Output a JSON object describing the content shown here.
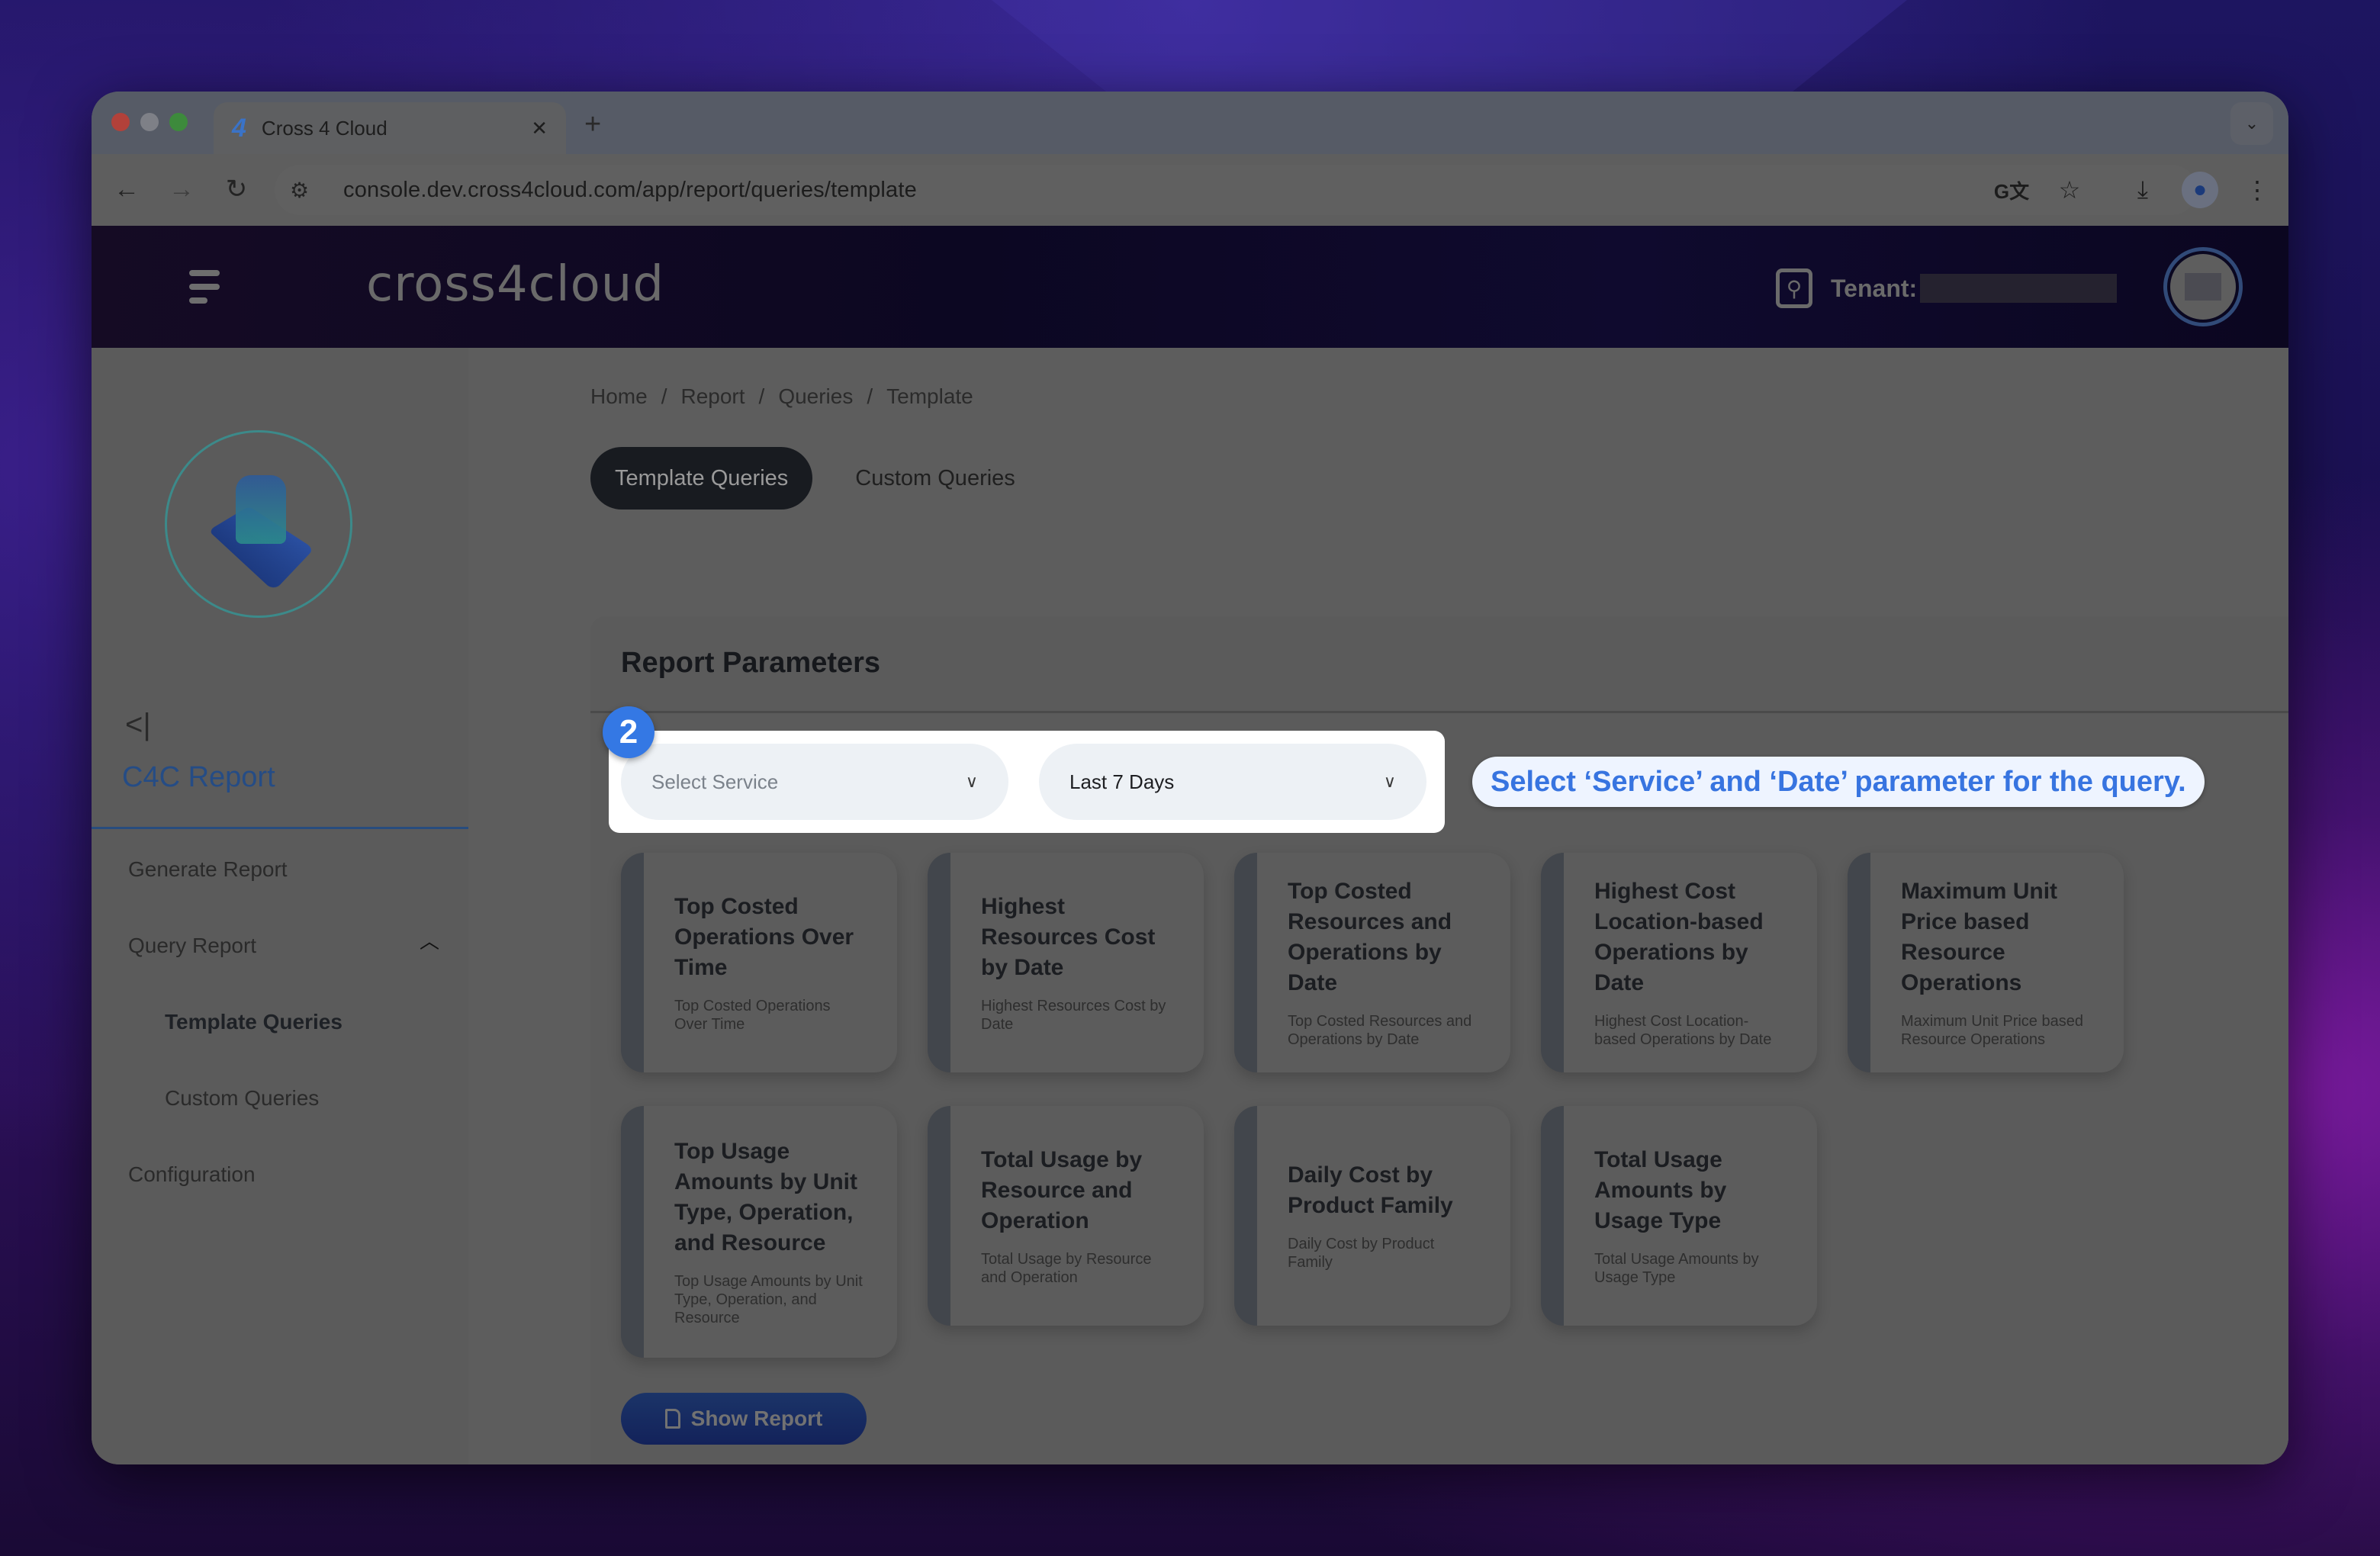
{
  "browser": {
    "tab_title": "Cross 4 Cloud",
    "tab_favicon": "4",
    "new_tab_label": "+",
    "url": "console.dev.cross4cloud.com/app/report/queries/template"
  },
  "header": {
    "logo_text": "cross4cloud",
    "tenant_label": "Tenant:",
    "tenant_value": ""
  },
  "sidebar": {
    "section_title": "C4C Report",
    "collapse_glyph": "<|",
    "items": [
      {
        "label": "Generate Report"
      },
      {
        "label": "Query Report",
        "expanded": true
      },
      {
        "label": "Template Queries",
        "active": true,
        "sub": true
      },
      {
        "label": "Custom Queries",
        "sub": true
      },
      {
        "label": "Configuration"
      }
    ]
  },
  "breadcrumb": [
    "Home",
    "Report",
    "Queries",
    "Template"
  ],
  "tabs": [
    {
      "label": "Template Queries",
      "active": true
    },
    {
      "label": "Custom Queries",
      "active": false
    }
  ],
  "panel": {
    "title": "Report Parameters",
    "service_select": {
      "placeholder": "Select Service",
      "value": ""
    },
    "date_select": {
      "value": "Last 7 Days"
    },
    "step_number": "2",
    "callout": "Select ‘Service’ and ‘Date’ parameter for the query."
  },
  "cards": [
    {
      "title": "Top Costed Operations Over Time",
      "desc": "Top Costed Operations Over Time"
    },
    {
      "title": "Highest Resources Cost by Date",
      "desc": "Highest Resources Cost by Date"
    },
    {
      "title": "Top Costed Resources and Operations by Date",
      "desc": "Top Costed Resources and Operations by Date"
    },
    {
      "title": "Highest Cost Location-based Operations by Date",
      "desc": "Highest Cost Location-based Operations by Date"
    },
    {
      "title": "Maximum Unit Price based Resource Operations",
      "desc": "Maximum Unit Price based Resource Operations"
    },
    {
      "title": "Top Usage Amounts by Unit Type, Operation, and Resource",
      "desc": "Top Usage Amounts by Unit Type, Operation, and Resource"
    },
    {
      "title": "Total Usage by Resource and Operation",
      "desc": "Total Usage by Resource and Operation"
    },
    {
      "title": "Daily Cost by Product Family",
      "desc": "Daily Cost by Product Family"
    },
    {
      "title": "Total Usage Amounts by Usage Type",
      "desc": "Total Usage Amounts by Usage Type"
    }
  ],
  "show_report_label": "Show Report",
  "colors": {
    "accent_blue": "#3478e4",
    "callout_text": "#3774e0",
    "section_title": "#254c85",
    "button_bg": "#1b3468"
  }
}
